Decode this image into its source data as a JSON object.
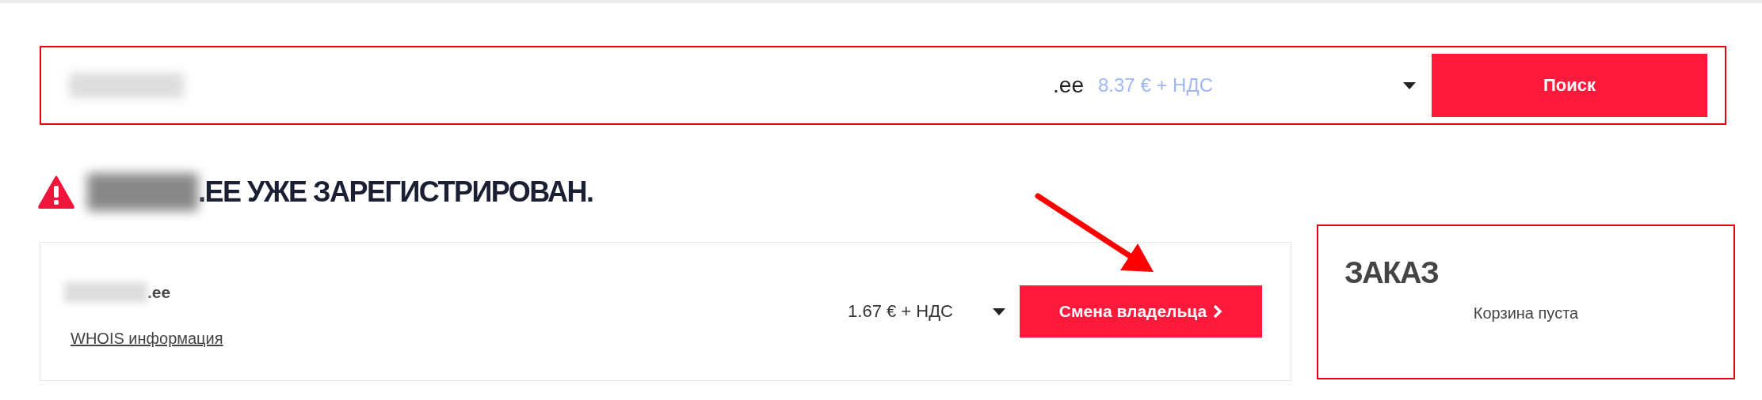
{
  "search": {
    "tld": ".ee",
    "price": "8.37 € + НДС",
    "button": "Поиск"
  },
  "result": {
    "heading": ".EE УЖЕ ЗАРЕГИСТРИРОВАН.",
    "domain": ".ee",
    "whois_link": "WHOIS информация",
    "price": "1.67 € + НДС",
    "button": "Смена владельца"
  },
  "order": {
    "title": "ЗАКАЗ",
    "empty_text": "Корзина пуста"
  }
}
